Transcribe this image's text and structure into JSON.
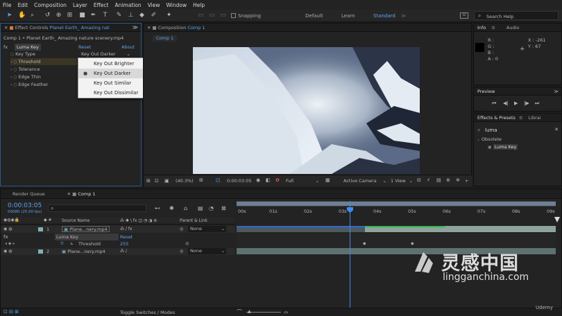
{
  "menu": [
    "File",
    "Edit",
    "Composition",
    "Layer",
    "Effect",
    "Animation",
    "View",
    "Window",
    "Help"
  ],
  "toolbar": {
    "snapping": "Snapping",
    "workspaces": [
      "Default",
      "Learn",
      "Standard"
    ],
    "active_workspace": "Standard",
    "search_placeholder": "Search Help"
  },
  "effect_controls": {
    "tab_prefix": "Effect Controls",
    "tab_layer": "Planet Earth_ Amazing nat",
    "breadcrumb": "Comp 1 • Planet Earth_ Amazing nature scenery.mp4",
    "effect_name": "Luma Key",
    "reset": "Reset",
    "about": "About",
    "properties": [
      {
        "label": "Key Type",
        "value": "Key Out Darker"
      },
      {
        "label": "Threshold",
        "value": ""
      },
      {
        "label": "Tolerance",
        "value": ""
      },
      {
        "label": "Edge Thin",
        "value": ""
      },
      {
        "label": "Edge Feather",
        "value": ""
      }
    ]
  },
  "dropdown": {
    "options": [
      "Key Out Brighter",
      "Key Out Darker",
      "Key Out Similar",
      "Key Out Dissimilar"
    ],
    "selected": "Key Out Darker"
  },
  "composition": {
    "tab_prefix": "Composition",
    "tab_name": "Comp 1",
    "subtab": "Comp 1",
    "timecode": "0:00:03:05",
    "zoom": "(40.3%)",
    "resolution": "Full",
    "camera": "Active Camera",
    "views": "1 View"
  },
  "info": {
    "tab": "Info",
    "audio": "Audio",
    "r": "R :",
    "g": "G :",
    "b": "B :",
    "a": "A : 0",
    "x": "X : -261",
    "y": "Y : 67"
  },
  "preview": {
    "tab": "Preview"
  },
  "effects_presets": {
    "tab": "Effects & Presets",
    "other_tab": "Librai",
    "search": "luma",
    "category": "Obsolete",
    "item": "Luma Key"
  },
  "timeline": {
    "tabs": [
      "Render Queue",
      "Comp 1"
    ],
    "timecode": "0:00:03:05",
    "frames": "00080 (25.00 fps)",
    "col_source": "Source Name",
    "col_parent": "Parent & Link",
    "layers": [
      {
        "num": "1",
        "name": "Plane...nery.mp4",
        "parent": "None"
      },
      {
        "num": "2",
        "name": "Plane...nery.mp4",
        "parent": "None"
      }
    ],
    "effect": "Luma Key",
    "effect_reset": "Reset",
    "prop": "Threshold",
    "prop_value": "255",
    "ticks": [
      "00s",
      "01s",
      "02s",
      "03s",
      "04s",
      "05s",
      "06s",
      "07s",
      "08s",
      "09s"
    ],
    "toggle": "Toggle Switches / Modes"
  },
  "watermark": {
    "cn": "灵感中国",
    "url": "lingganchina.com",
    "udemy": "Udemy"
  }
}
